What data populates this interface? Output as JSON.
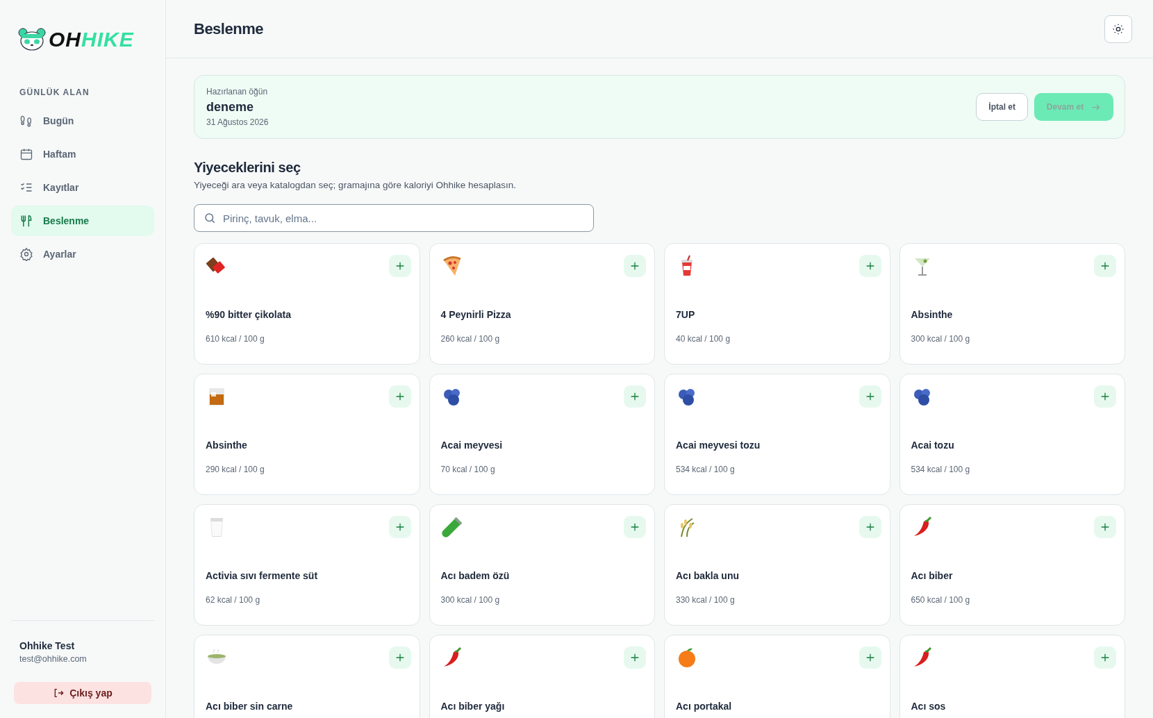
{
  "sidebar": {
    "logo": {
      "part_1": "OH",
      "part_2": "HIKE"
    },
    "section_title": "GÜNLÜK ALAN",
    "items": [
      {
        "label": "Bugün",
        "kind": "footprints",
        "selected": false
      },
      {
        "label": "Haftam",
        "kind": "calendar",
        "selected": false
      },
      {
        "label": "Kayıtlar",
        "kind": "checklist",
        "selected": false
      },
      {
        "label": "Beslenme",
        "kind": "utensils",
        "selected": true
      },
      {
        "label": "Ayarlar",
        "kind": "gear",
        "selected": false
      }
    ],
    "user": {
      "name": "Ohhike Test",
      "email": "test@ohhike.com"
    },
    "logout": "Çıkış yap"
  },
  "header": {
    "title": "Beslenme"
  },
  "meal": {
    "label": "Hazırlanan öğün",
    "name": "deneme",
    "date": "31 Ağustos 2026",
    "cancel": "İptal et",
    "continue": {
      "label": "Devam et",
      "disabled": true
    }
  },
  "picker": {
    "title": "Yiyeceklerini seç",
    "subtitle": "Yiyeceği ara veya katalogdan seç; gramajına göre kaloriyi Ohhike hesaplasın.",
    "search": {
      "placeholder": "Pirinç, tavuk, elma..."
    }
  },
  "foods": [
    {
      "name": "%90 bitter çikolata",
      "kcal": "610 kcal / 100 g",
      "kind": "chocolate"
    },
    {
      "name": "4 Peynirli Pizza",
      "kcal": "260 kcal / 100 g",
      "kind": "pizza"
    },
    {
      "name": "7UP",
      "kcal": "40 kcal / 100 g",
      "kind": "cup"
    },
    {
      "name": "Absinthe",
      "kcal": "300 kcal / 100 g",
      "kind": "cocktail"
    },
    {
      "name": "Absinthe",
      "kcal": "290 kcal / 100 g",
      "kind": "whisky"
    },
    {
      "name": "Acai meyvesi",
      "kcal": "70 kcal / 100 g",
      "kind": "berries"
    },
    {
      "name": "Acai meyvesi tozu",
      "kcal": "534 kcal / 100 g",
      "kind": "berries"
    },
    {
      "name": "Acai tozu",
      "kcal": "534 kcal / 100 g",
      "kind": "berries"
    },
    {
      "name": "Activia sıvı fermente süt",
      "kcal": "62 kcal / 100 g",
      "kind": "milk"
    },
    {
      "name": "Acı badem özü",
      "kcal": "300 kcal / 100 g",
      "kind": "tube"
    },
    {
      "name": "Acı bakla unu",
      "kcal": "330 kcal / 100 g",
      "kind": "grain"
    },
    {
      "name": "Acı biber",
      "kcal": "650 kcal / 100 g",
      "kind": "chili"
    },
    {
      "name": "Acı biber sin carne",
      "kind": "bowl"
    },
    {
      "name": "Acı biber yağı",
      "kind": "chili"
    },
    {
      "name": "Acı portakal",
      "kind": "orange"
    },
    {
      "name": "Acı sos",
      "kind": "chili"
    }
  ]
}
